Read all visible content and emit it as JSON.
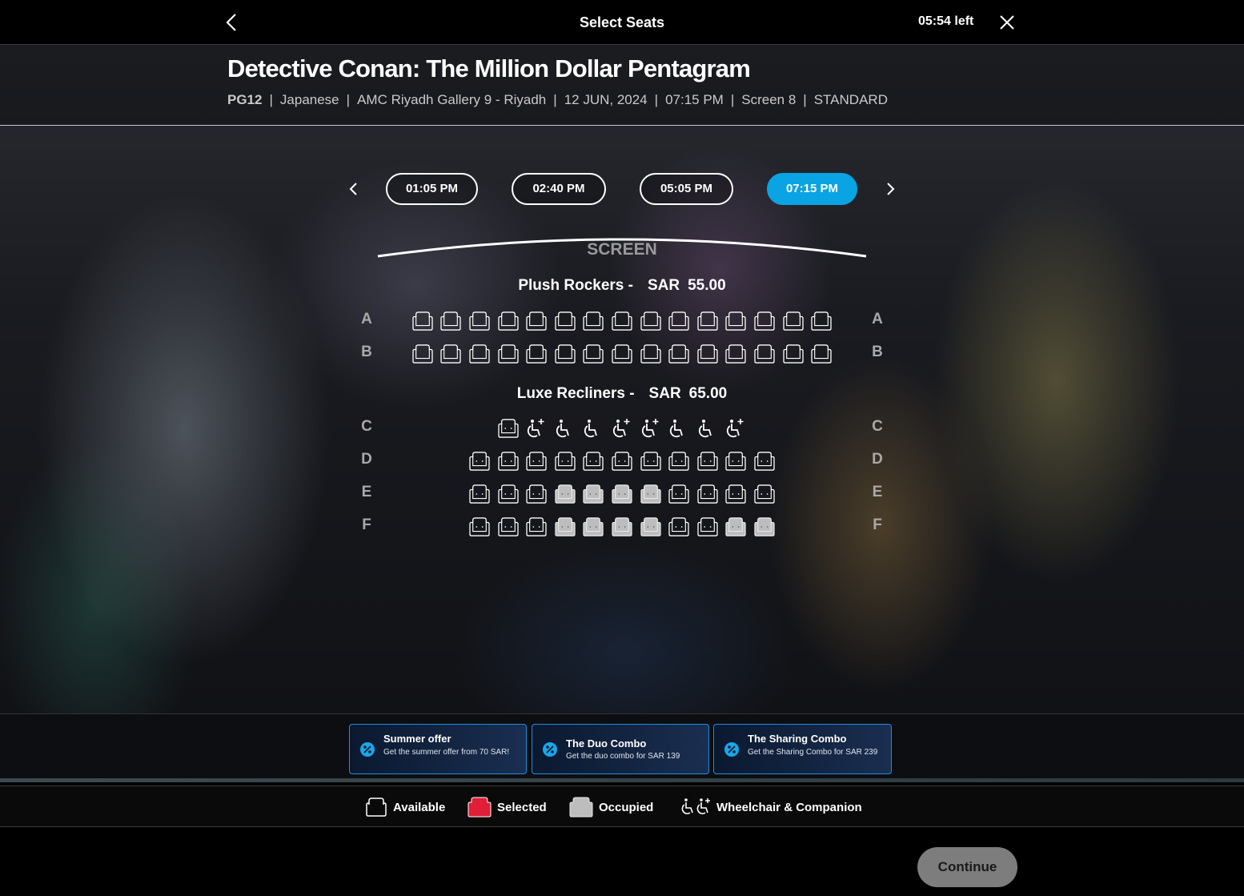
{
  "header": {
    "title": "Select Seats",
    "timer": "05:54 left"
  },
  "movie": {
    "title": "Detective Conan: The Million Dollar Pentagram",
    "rating": "PG12",
    "language": "Japanese",
    "cinema": "AMC Riyadh Gallery 9 - Riyadh",
    "date": "12 JUN, 2024",
    "time": "07:15 PM",
    "screen": "Screen 8",
    "format": "STANDARD"
  },
  "showtimes": [
    {
      "label": "01:05 PM",
      "selected": false
    },
    {
      "label": "02:40 PM",
      "selected": false
    },
    {
      "label": "05:05 PM",
      "selected": false
    },
    {
      "label": "07:15 PM",
      "selected": true
    }
  ],
  "screen_label": "SCREEN",
  "sections": [
    {
      "name": "Plush Rockers -",
      "currency": "SAR",
      "price": "55.00",
      "seat_type": "rocker",
      "rows": [
        {
          "letter": "A",
          "seats": [
            "available",
            "available",
            "available",
            "available",
            "available",
            "available",
            "available",
            "available",
            "available",
            "available",
            "available",
            "available",
            "available",
            "available",
            "available"
          ]
        },
        {
          "letter": "B",
          "seats": [
            "available",
            "available",
            "available",
            "available",
            "available",
            "available",
            "available",
            "available",
            "available",
            "available",
            "available",
            "available",
            "available",
            "available",
            "available"
          ]
        }
      ]
    },
    {
      "name": "Luxe Recliners -",
      "currency": "SAR",
      "price": "65.00",
      "seat_type": "recliner",
      "rows": [
        {
          "letter": "C",
          "seats": [
            "available",
            "companion",
            "wheelchair",
            "wheelchair",
            "companion",
            "companion",
            "wheelchair",
            "wheelchair",
            "companion"
          ]
        },
        {
          "letter": "D",
          "seats": [
            "available",
            "available",
            "available",
            "available",
            "available",
            "available",
            "available",
            "available",
            "available",
            "available",
            "available"
          ]
        },
        {
          "letter": "E",
          "seats": [
            "available",
            "available",
            "available",
            "occupied",
            "occupied",
            "occupied",
            "occupied",
            "available",
            "available",
            "available",
            "available"
          ]
        },
        {
          "letter": "F",
          "seats": [
            "available",
            "available",
            "available",
            "occupied",
            "occupied",
            "occupied",
            "occupied",
            "available",
            "available",
            "occupied",
            "occupied"
          ]
        }
      ]
    }
  ],
  "offers": [
    {
      "title": "Summer offer",
      "desc": "Get the summer offer from 70 SAR!",
      "icon": "percent-badge-icon"
    },
    {
      "title": "The Duo Combo",
      "desc": "Get the duo combo for SAR 139",
      "icon": "percent-badge-icon"
    },
    {
      "title": "The Sharing Combo",
      "desc": "Get the Sharing Combo for SAR 239",
      "icon": "percent-badge-icon"
    }
  ],
  "legend": {
    "available": "Available",
    "selected": "Selected",
    "occupied": "Occupied",
    "wheelchair": "Wheelchair & Companion"
  },
  "colors": {
    "accent": "#0aa3e3",
    "selected_seat": "#e01e37",
    "occupied_seat": "#bdbdbd",
    "continue_disabled": "#7d7d7d"
  },
  "continue_label": "Continue"
}
